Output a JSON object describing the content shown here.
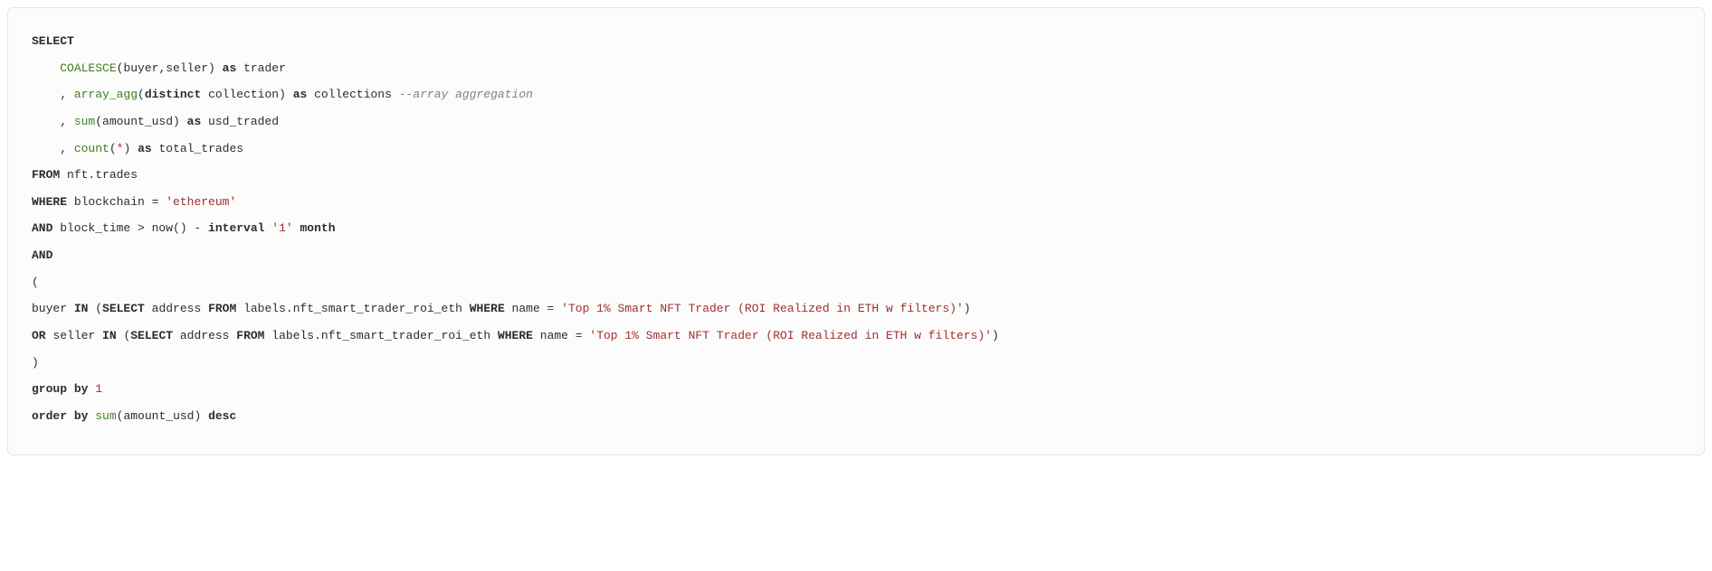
{
  "code": {
    "line1": {
      "t1": "SELECT"
    },
    "line2": {
      "t1": "    ",
      "t2": "COALESCE",
      "t3": "(buyer,seller) ",
      "t4": "as",
      "t5": " trader"
    },
    "line3": {
      "t1": "    , ",
      "t2": "array_agg",
      "t3": "(",
      "t4": "distinct",
      "t5": " collection) ",
      "t6": "as",
      "t7": " collections ",
      "t8": "--array aggregation"
    },
    "line4": {
      "t1": "    , ",
      "t2": "sum",
      "t3": "(amount_usd) ",
      "t4": "as",
      "t5": " usd_traded"
    },
    "line5": {
      "t1": "    , ",
      "t2": "count",
      "t3": "(",
      "t4": "*",
      "t5": ") ",
      "t6": "as",
      "t7": " total_trades"
    },
    "line6": {
      "t1": "FROM",
      "t2": " nft.trades"
    },
    "line7": {
      "t1": "WHERE",
      "t2": " blockchain = ",
      "t3": "'ethereum'"
    },
    "line8": {
      "t1": "AND",
      "t2": " block_time > now() - ",
      "t3": "interval",
      "t4": " ",
      "t5": "'1'",
      "t6": " ",
      "t7": "month"
    },
    "line9": {
      "t1": "AND"
    },
    "line10": {
      "t1": "("
    },
    "line11": {
      "t1": "buyer ",
      "t2": "IN",
      "t3": " (",
      "t4": "SELECT",
      "t5": " address ",
      "t6": "FROM",
      "t7": " labels.nft_smart_trader_roi_eth ",
      "t8": "WHERE",
      "t9": " name = ",
      "t10": "'Top 1% Smart NFT Trader (ROI Realized in ETH w filters)'",
      "t11": ")"
    },
    "line12": {
      "t1": "OR",
      "t2": " seller ",
      "t3": "IN",
      "t4": " (",
      "t5": "SELECT",
      "t6": " address ",
      "t7": "FROM",
      "t8": " labels.nft_smart_trader_roi_eth ",
      "t9": "WHERE",
      "t10": " name = ",
      "t11": "'Top 1% Smart NFT Trader (ROI Realized in ETH w filters)'",
      "t12": ")"
    },
    "line13": {
      "t1": ")"
    },
    "line14": {
      "t1": "group",
      "t2": " ",
      "t3": "by",
      "t4": " ",
      "t5": "1"
    },
    "line15": {
      "t1": "order",
      "t2": " ",
      "t3": "by",
      "t4": " ",
      "t5": "sum",
      "t6": "(amount_usd) ",
      "t7": "desc"
    }
  }
}
